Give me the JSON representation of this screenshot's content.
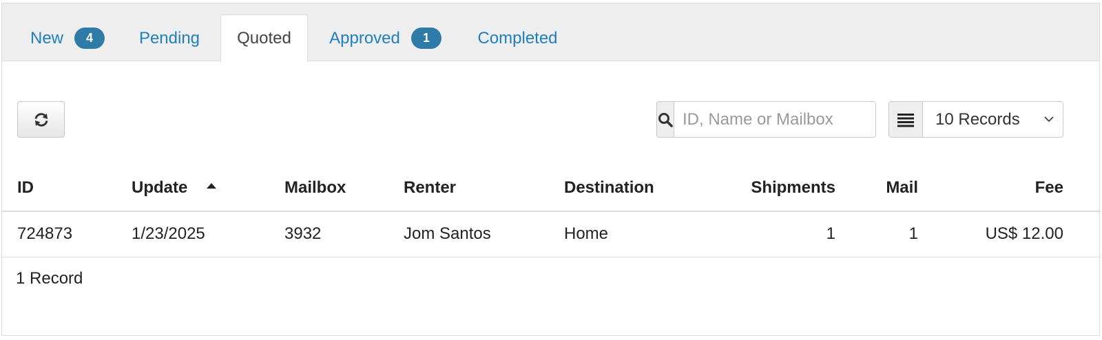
{
  "tabs": [
    {
      "label": "New",
      "badge": "4",
      "active": false
    },
    {
      "label": "Pending",
      "badge": "",
      "active": false
    },
    {
      "label": "Quoted",
      "badge": "",
      "active": true
    },
    {
      "label": "Approved",
      "badge": "1",
      "active": false
    },
    {
      "label": "Completed",
      "badge": "",
      "active": false
    }
  ],
  "toolbar": {
    "refresh_icon": "refresh-icon",
    "search_icon": "search-icon",
    "search_placeholder": "ID, Name or Mailbox",
    "search_value": "",
    "records_icon": "list-icon",
    "records_selected": "10 Records"
  },
  "table": {
    "columns": [
      "ID",
      "Update",
      "Mailbox",
      "Renter",
      "Destination",
      "Shipments",
      "Mail",
      "Fee"
    ],
    "sorted_column": "Update",
    "sort_direction": "ascending",
    "rows": [
      {
        "id": "724873",
        "update": "1/23/2025",
        "mailbox": "3932",
        "renter": "Jom Santos",
        "destination": "Home",
        "shipments": "1",
        "mail": "1",
        "fee": "US$ 12.00"
      }
    ]
  },
  "footer": {
    "record_count": "1 Record"
  },
  "colors": {
    "link": "#1f7fbf",
    "badge": "#2f7ba7",
    "tabbar_bg": "#eeeeee",
    "border": "#dddddd"
  }
}
